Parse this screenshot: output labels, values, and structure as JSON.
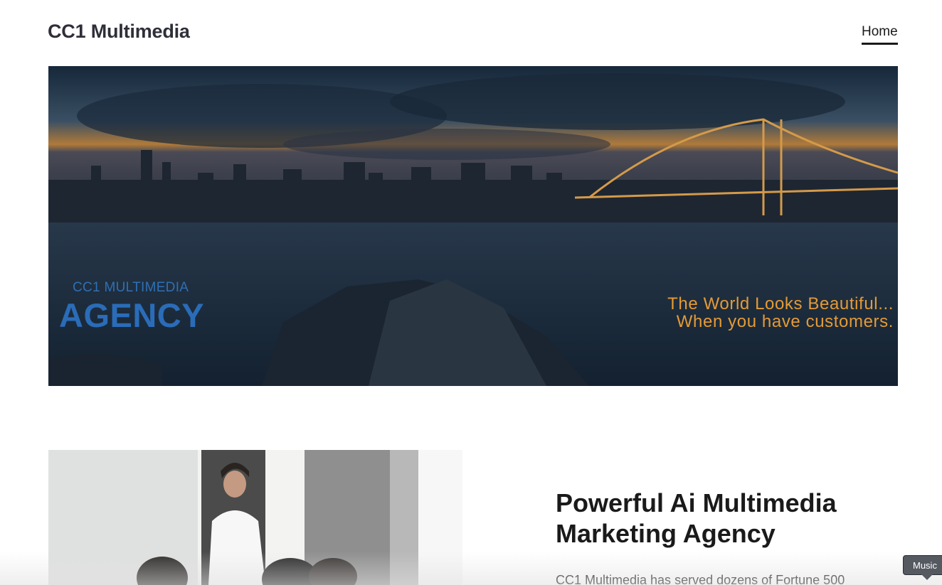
{
  "header": {
    "site_title": "CC1 Multimedia",
    "nav": [
      {
        "label": "Home"
      }
    ]
  },
  "hero": {
    "kicker": "CC1 MULTIMEDIA",
    "title": "AGENCY",
    "tagline_line1": "The World Looks Beautiful...",
    "tagline_line2": "When you have customers.",
    "colors": {
      "kicker": "#2f6fb3",
      "title": "#2a6cb8",
      "tagline": "#e59a36"
    }
  },
  "feature": {
    "heading": "Powerful Ai Multimedia Marketing Agency",
    "body": "CC1 Multimedia has served dozens of Fortune 500"
  },
  "tooltip": {
    "label": "Music"
  }
}
